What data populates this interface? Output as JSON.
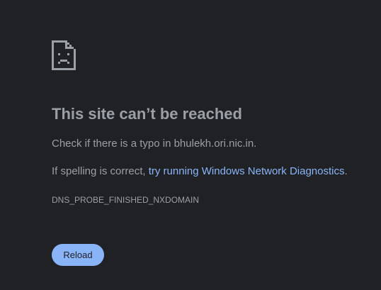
{
  "colors": {
    "background": "#202124",
    "text": "#9aa0a6",
    "link": "#8ab4f8",
    "button_bg": "#8ab4f8",
    "button_text": "#202124"
  },
  "icon": "sad-page-icon",
  "error": {
    "title": "This site can’t be reached",
    "typo_prefix": "Check if there is a typo in ",
    "domain": "bhulekh.ori.nic.in",
    "typo_suffix": ".",
    "spelling_prefix": "If spelling is correct, ",
    "diagnostics_link": "try running Windows Network Diagnostics",
    "spelling_suffix": ".",
    "code": "DNS_PROBE_FINISHED_NXDOMAIN"
  },
  "actions": {
    "reload_label": "Reload"
  }
}
